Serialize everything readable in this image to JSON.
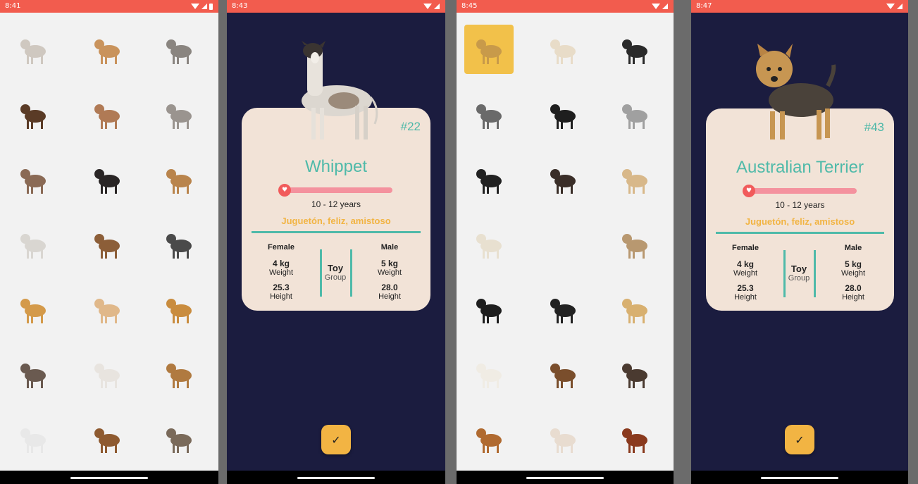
{
  "screens": [
    {
      "type": "grid",
      "time": "8:41"
    },
    {
      "type": "detail",
      "time": "8:43",
      "number": "#22",
      "name": "Whippet",
      "life": "10 - 12 years",
      "temperament": "Juguetón, feliz, amistoso",
      "female_label": "Female",
      "male_label": "Male",
      "female_weight": "4 kg",
      "female_height": "25.3",
      "male_weight": "5 kg",
      "male_height": "28.0",
      "weight_label": "Weight",
      "height_label": "Height",
      "group_value": "Toy",
      "group_label": "Group",
      "life_fraction": 0.0
    },
    {
      "type": "grid",
      "time": "8:45"
    },
    {
      "type": "detail",
      "time": "8:47",
      "number": "#43",
      "name": "Australian Terrier",
      "life": "10 - 12 years",
      "temperament": "Juguetón, feliz, amistoso",
      "female_label": "Female",
      "male_label": "Male",
      "female_weight": "4 kg",
      "female_height": "25.3",
      "male_weight": "5 kg",
      "male_height": "28.0",
      "weight_label": "Weight",
      "height_label": "Height",
      "group_value": "Toy",
      "group_label": "Group",
      "life_fraction": 0.0
    }
  ],
  "colors": {
    "status_bar": "#f25c4e",
    "grid_bg": "#f2f2f2",
    "detail_bg": "#1b1c3f",
    "card": "#f2e3d7",
    "accent_teal": "#4fbaa9",
    "accent_yellow": "#f2b443",
    "life_bar": "#f4929e",
    "life_knob": "#f15b5b"
  },
  "icons": {
    "confirm": "check-icon",
    "life": "heart-icon",
    "wifi": "wifi-icon",
    "signal": "signal-icon",
    "battery": "battery-icon"
  }
}
